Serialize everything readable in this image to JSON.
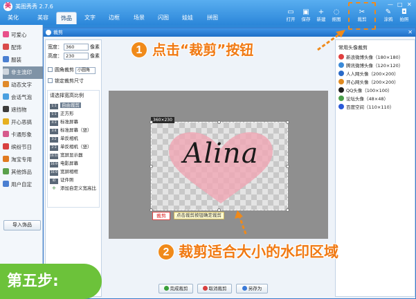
{
  "app": {
    "title": "美图秀秀 2.7.6",
    "tabs": [
      {
        "label": "美化"
      },
      {
        "label": "美容"
      },
      {
        "label": "饰品"
      },
      {
        "label": "文字"
      },
      {
        "label": "边框"
      },
      {
        "label": "场景"
      },
      {
        "label": "闪图"
      },
      {
        "label": "娃娃"
      },
      {
        "label": "拼图"
      }
    ],
    "active_tab": "饰品",
    "toolbar": [
      {
        "label": "打开",
        "icon": "folder-icon"
      },
      {
        "label": "保存",
        "icon": "save-icon"
      },
      {
        "label": "新建",
        "icon": "new-icon"
      },
      {
        "label": "抠图",
        "icon": "cutout-icon"
      },
      {
        "label": "裁剪",
        "icon": "scissors-icon"
      },
      {
        "label": "涂鸦",
        "icon": "brush-icon"
      },
      {
        "label": "拍照",
        "icon": "camera-icon"
      }
    ],
    "categories": [
      {
        "label": "可爱心",
        "color": "#e8508a"
      },
      {
        "label": "配饰",
        "color": "#d94b4b"
      },
      {
        "label": "服装",
        "color": "#4a7fd1"
      },
      {
        "label": "非主流印",
        "color": "#999999",
        "selected": true
      },
      {
        "label": "动态文字",
        "color": "#e08a2a"
      },
      {
        "label": "会话气泡",
        "color": "#4aa0e0"
      },
      {
        "label": "遮挡物",
        "color": "#3c3c3c"
      },
      {
        "label": "开心恶搞",
        "color": "#e6b020"
      },
      {
        "label": "卡通形象",
        "color": "#d65a8c"
      },
      {
        "label": "缤纷节日",
        "color": "#d84040"
      },
      {
        "label": "淘宝专用",
        "color": "#e07a20"
      },
      {
        "label": "其他饰品",
        "color": "#5aa04a"
      },
      {
        "label": "用户自定",
        "color": "#4a7fd1"
      }
    ],
    "import_label": "导入饰品"
  },
  "dialog": {
    "title": "裁剪",
    "width_label": "宽度：",
    "width_value": "360",
    "height_label": "高度：",
    "height_value": "230",
    "unit": "像素",
    "round_corner_label": "圆角裁剪",
    "round_corner_option": "小圆角",
    "lock_size_label": "锁定裁剪尺寸",
    "ratio_heading": "请选择宽高比例",
    "ratios": [
      {
        "icon": "1:1",
        "label": "自由裁剪",
        "selected": true
      },
      {
        "icon": "1:1",
        "label": "正方形"
      },
      {
        "icon": "4:3",
        "label": "标准屏幕"
      },
      {
        "icon": "3:4",
        "label": "标准屏幕（竖）"
      },
      {
        "icon": "3:2",
        "label": "单反相机"
      },
      {
        "icon": "2:3",
        "label": "单反相机（竖）"
      },
      {
        "icon": "16:10",
        "label": "宽屏显示器"
      },
      {
        "icon": "16:9",
        "label": "电影屏幕"
      },
      {
        "icon": "16:9",
        "label": "宽屏相框"
      },
      {
        "icon": "ID",
        "label": "证件照"
      },
      {
        "icon": "+",
        "label": "添加自定义宽高比"
      }
    ],
    "size_tag": "360×230",
    "watermark_text": "Alina",
    "crop_button_label": "裁剪",
    "crop_hint": "点击裁剪按钮确定裁剪",
    "preset_heading": "常用头像裁剪",
    "presets": [
      {
        "label": "新浪微博头像（180×180）",
        "color": "#e04040"
      },
      {
        "label": "腾讯微博头像（120×120）",
        "color": "#3a8ad8"
      },
      {
        "label": "人人网头像（200×200）",
        "color": "#2a6ac8"
      },
      {
        "label": "开心网头像（200×200）",
        "color": "#e08a20"
      },
      {
        "label": "QQ头像（100×100）",
        "color": "#202020"
      },
      {
        "label": "论坛头像（48×48）",
        "color": "#4aa04a"
      },
      {
        "label": "百度空间（110×110）",
        "color": "#2a5ad8"
      }
    ],
    "buttons": [
      {
        "label": "完成裁剪",
        "color": "#3aa03a"
      },
      {
        "label": "取消裁剪",
        "color": "#d84040"
      },
      {
        "label": "另存为",
        "color": "#3a7ad8"
      }
    ]
  },
  "annotations": {
    "step1_number": "1",
    "step1_text": "点击“裁剪”按钮",
    "step2_number": "2",
    "step2_text": "裁剪适合大小的水印区域",
    "step_label": "第五步:",
    "accent_color": "#f08a1a",
    "step_color": "#6cc23a"
  }
}
